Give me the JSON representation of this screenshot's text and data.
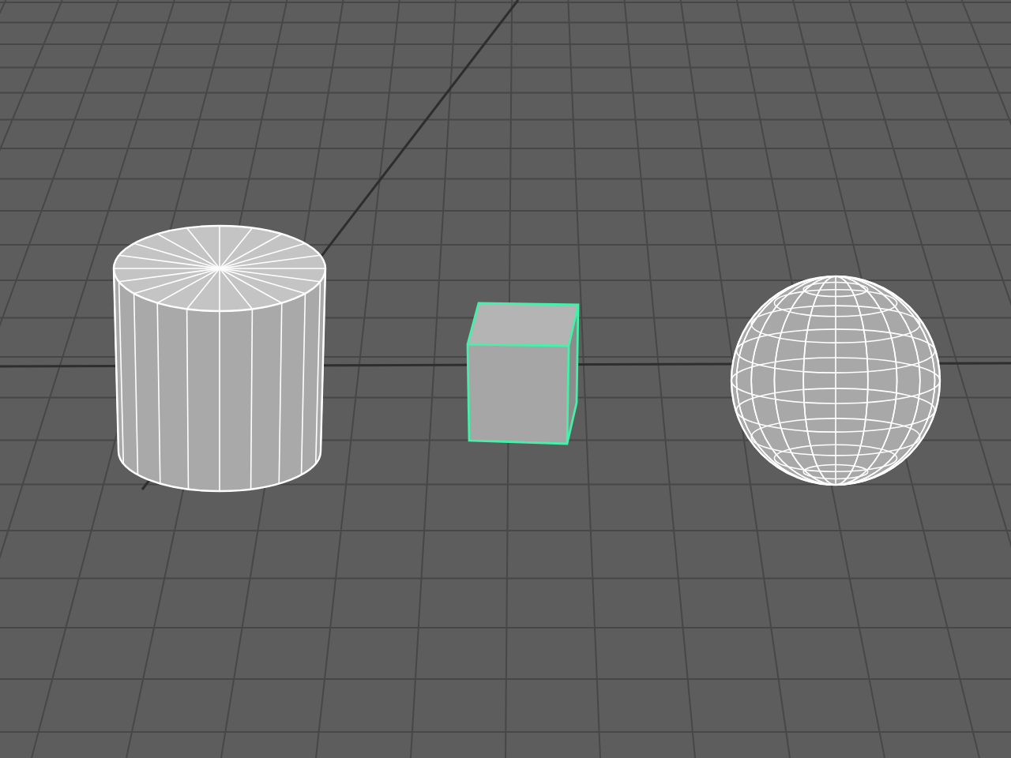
{
  "viewport": {
    "objects": [
      {
        "kind": "cylinder",
        "selected": false
      },
      {
        "kind": "cube",
        "selected": true
      },
      {
        "kind": "sphere",
        "selected": false
      }
    ]
  }
}
